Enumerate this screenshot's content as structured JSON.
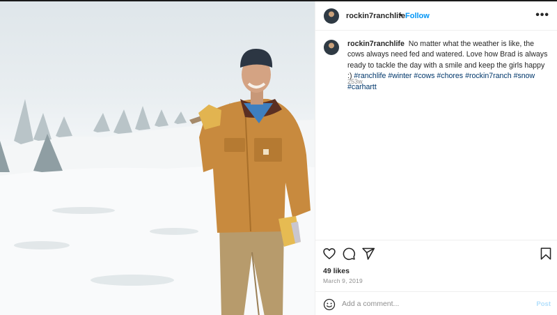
{
  "post": {
    "author": "rockin7ranchlife",
    "follow_label": "Follow",
    "separator": "•",
    "more_icon": "more-icon",
    "caption_text": "No matter what the weather is like, the cows always need fed and watered. Love how Brad is always ready to tackle the day with a smile and keep the girls happy :) ",
    "hashtags": [
      "#ranchlife",
      "#winter",
      "#cows",
      "#chores",
      "#rockin7ranch",
      "#snow",
      "#carhartt"
    ],
    "age": "253w",
    "likes": "49 likes",
    "date": "March 9, 2019"
  },
  "actions": {
    "icons": [
      "heart-icon",
      "comment-icon",
      "share-icon",
      "bookmark-icon"
    ]
  },
  "comment": {
    "placeholder": "Add a comment...",
    "post_label": "Post",
    "emoji_icon": "smile-icon"
  },
  "colors": {
    "link_blue": "#0095f6",
    "hashtag": "#00376b",
    "muted": "#8e8e8e",
    "jacket": "#c88a3e"
  }
}
